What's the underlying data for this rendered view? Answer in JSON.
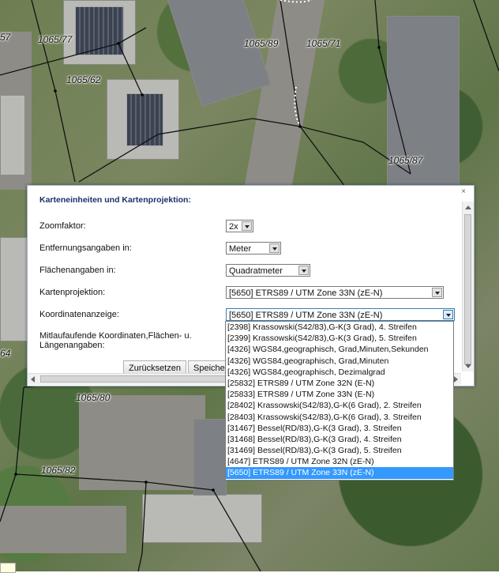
{
  "map": {
    "parcels": [
      "57",
      "1065/77",
      "1065/62",
      "1065/89",
      "1065/71",
      "1065/87",
      "64",
      "1065/80",
      "1065/82"
    ]
  },
  "dialog": {
    "title": "Karteneinheiten und Kartenprojektion:",
    "rows": {
      "zoom": {
        "label": "Zoomfaktor:",
        "value": "2x"
      },
      "distance": {
        "label": "Entfernungsangaben in:",
        "value": "Meter"
      },
      "area": {
        "label": "Flächenangaben in:",
        "value": "Quadratmeter"
      },
      "projection": {
        "label": "Kartenprojektion:",
        "value": "[5650] ETRS89 / UTM Zone 33N (zE-N)"
      },
      "coordinates": {
        "label": "Koordinatenanzeige:",
        "value": "[5650] ETRS89 / UTM Zone 33N (zE-N)"
      },
      "live_label_line1": "Mitlaufaufende Koordinaten,Flächen- u.",
      "live_label_line2": "Längenangaben:"
    },
    "buttons": {
      "reset": "Zurücksetzen",
      "save": "Speiche"
    }
  },
  "dropdown": {
    "options": [
      "[2398] Krassowski(S42/83),G-K(3 Grad), 4. Streifen",
      "[2399] Krassowski(S42/83),G-K(3 Grad), 5. Streifen",
      "[4326] WGS84,geographisch, Grad,Minuten,Sekunden",
      "[4326] WGS84,geographisch, Grad,Minuten",
      "[4326] WGS84,geographisch, Dezimalgrad",
      "[25832] ETRS89 / UTM Zone 32N (E-N)",
      "[25833] ETRS89 / UTM Zone 33N (E-N)",
      "[28402] Krassowski(S42/83),G-K(6 Grad), 2. Streifen",
      "[28403] Krassowski(S42/83),G-K(6 Grad), 3. Streifen",
      "[31467] Bessel(RD/83),G-K(3 Grad), 3. Streifen",
      "[31468] Bessel(RD/83),G-K(3 Grad), 4. Streifen",
      "[31469] Bessel(RD/83),G-K(3 Grad), 5. Streifen",
      "[4647] ETRS89 / UTM Zone 32N (zE-N)",
      "[5650] ETRS89 / UTM Zone 33N (zE-N)"
    ],
    "selected_index": 13
  },
  "colors": {
    "selection": "#3399ff",
    "title": "#1a2f6b",
    "dialog_border": "#9fb1c9"
  }
}
